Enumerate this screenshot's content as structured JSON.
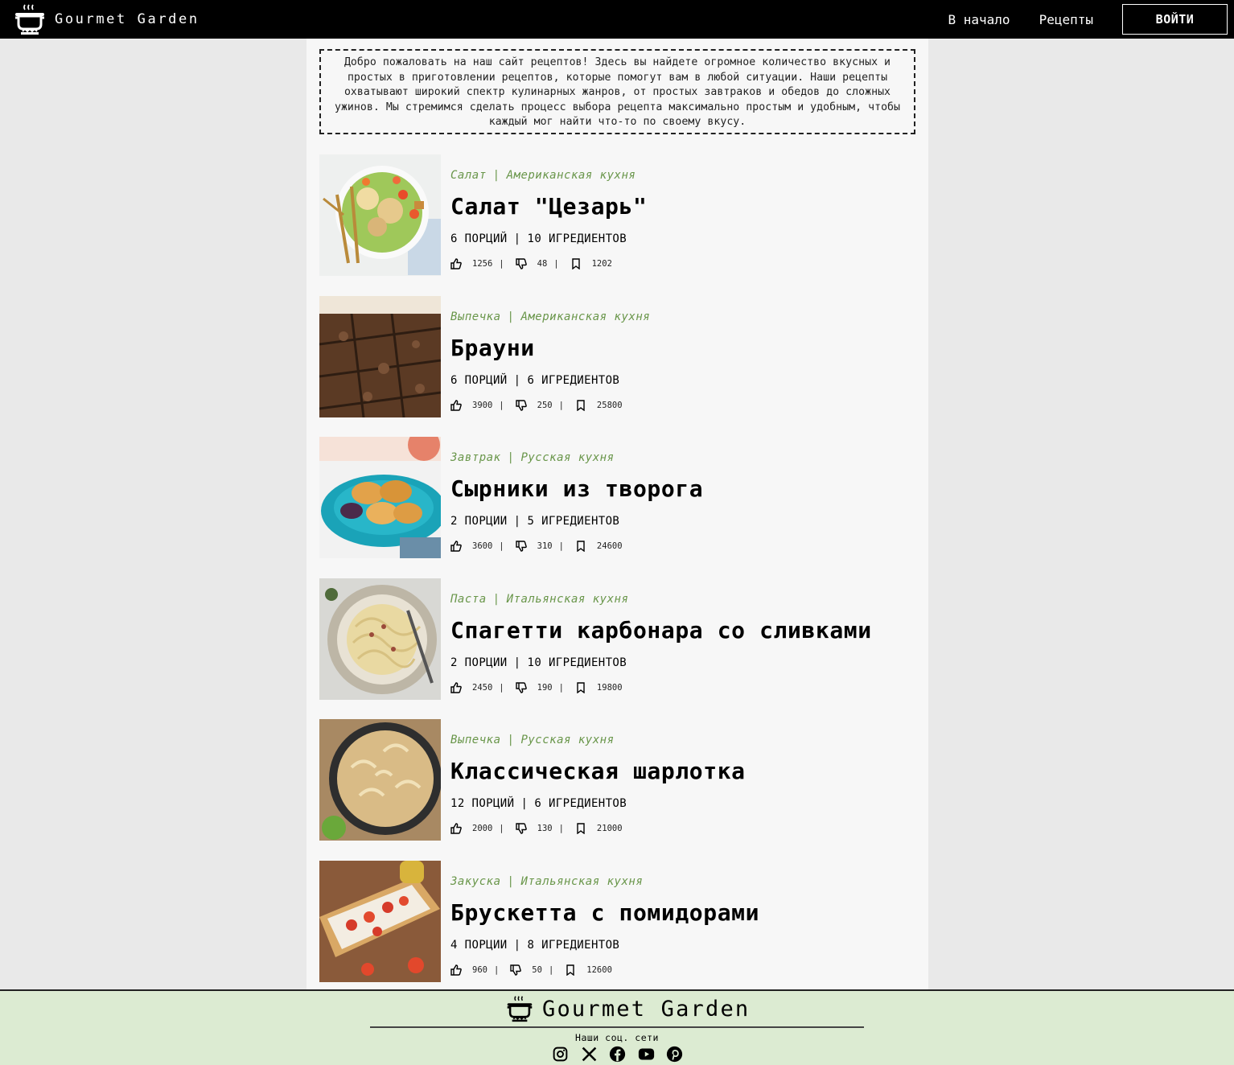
{
  "header": {
    "brand": "Gourmet Garden",
    "nav": {
      "home": "В начало",
      "recipes": "Рецепты",
      "login": "ВОЙТИ"
    }
  },
  "intro": "Добро пожаловать на наш сайт рецептов! Здесь вы найдете огромное количество вкусных и простых в приготовлении рецептов, которые помогут вам в любой ситуации. Наши рецепты охватывают широкий спектр кулинарных жанров, от простых завтраков и обедов до сложных ужинов. Мы стремимся сделать процесс выбора рецепта максимально простым и удобным, чтобы каждый мог найти что-то по своему вкусу.",
  "recipes": [
    {
      "category": "Салат",
      "cuisine": "Американская кухня",
      "title": "Салат \"Цезарь\"",
      "servings": "6 ПОРЦИЙ",
      "ingredients": "10 ИГРЕДИЕНТОВ",
      "likes": "1256",
      "dislikes": "48",
      "saves": "1202"
    },
    {
      "category": "Выпечка",
      "cuisine": "Американская кухня",
      "title": "Брауни",
      "servings": "6 ПОРЦИЙ",
      "ingredients": "6 ИГРЕДИЕНТОВ",
      "likes": "3900",
      "dislikes": "250",
      "saves": "25800"
    },
    {
      "category": "Завтрак",
      "cuisine": "Русская кухня",
      "title": "Сырники из творога",
      "servings": "2 ПОРЦИИ",
      "ingredients": "5 ИГРЕДИЕНТОВ",
      "likes": "3600",
      "dislikes": "310",
      "saves": "24600"
    },
    {
      "category": "Паста",
      "cuisine": "Итальянская кухня",
      "title": "Спагетти карбонара со сливками",
      "servings": "2 ПОРЦИИ",
      "ingredients": "10 ИГРЕДИЕНТОВ",
      "likes": "2450",
      "dislikes": "190",
      "saves": "19800"
    },
    {
      "category": "Выпечка",
      "cuisine": "Русская кухня",
      "title": "Классическая шарлотка",
      "servings": "12 ПОРЦИЙ",
      "ingredients": "6 ИГРЕДИЕНТОВ",
      "likes": "2000",
      "dislikes": "130",
      "saves": "21000"
    },
    {
      "category": "Закуска",
      "cuisine": "Итальянская кухня",
      "title": "Брускетта с помидорами",
      "servings": "4 ПОРЦИИ",
      "ingredients": "8 ИГРЕДИЕНТОВ",
      "likes": "960",
      "dislikes": "50",
      "saves": "12600"
    }
  ],
  "footer": {
    "brand": "Gourmet Garden",
    "social_label": "Наши соц. сети",
    "socials": [
      "instagram-icon",
      "x-icon",
      "facebook-icon",
      "youtube-icon",
      "pinterest-icon"
    ]
  },
  "colors": {
    "accent_green": "#69964a",
    "footer_bg": "#dcebd2",
    "header_bg": "#000000"
  }
}
